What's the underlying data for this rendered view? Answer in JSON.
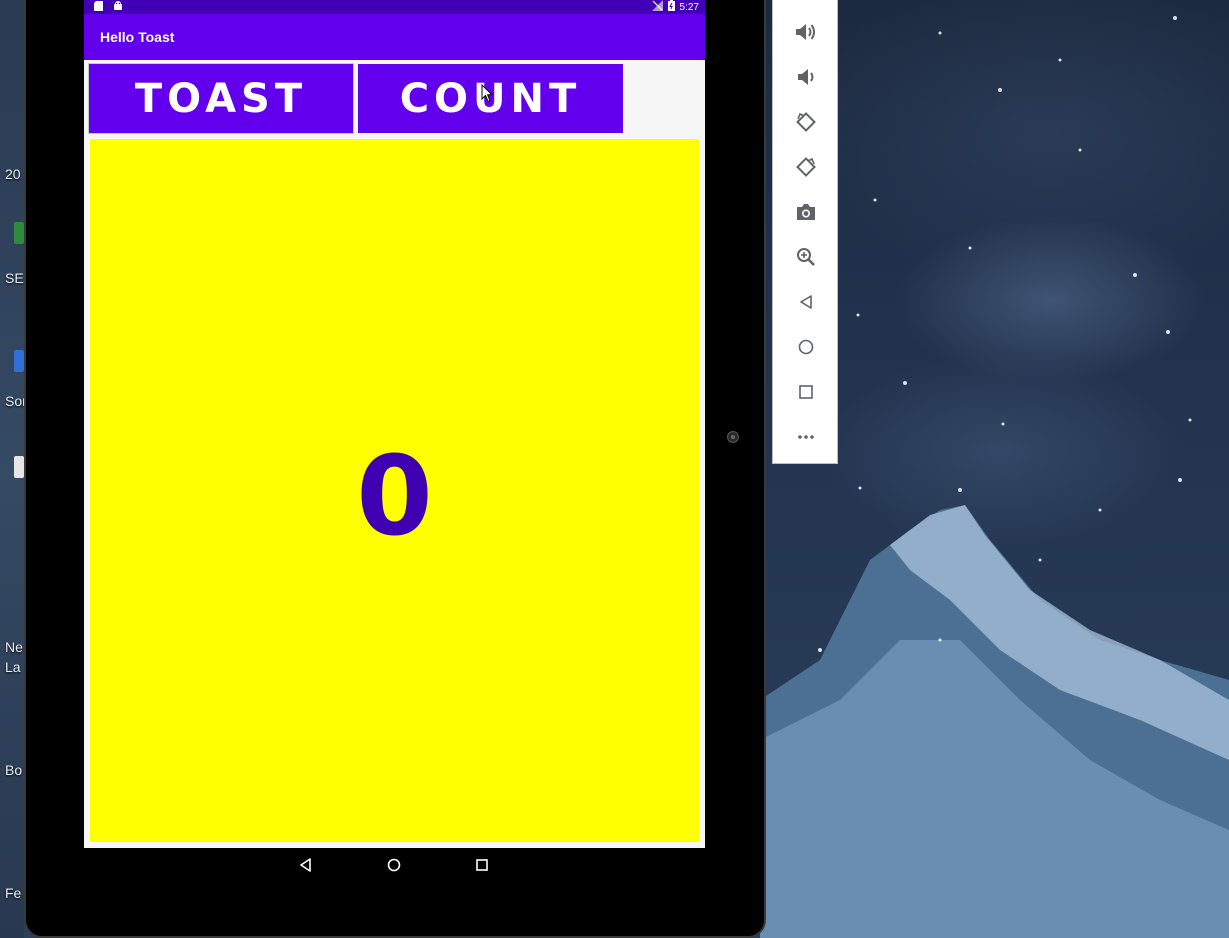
{
  "desktop": {
    "labels": [
      "20",
      "SE",
      "Sor",
      "Ne",
      "La",
      "Bo",
      "Fe"
    ]
  },
  "status_bar": {
    "time": "5:27",
    "icons": [
      "sd-card-icon",
      "android-icon",
      "no-signal-icon",
      "battery-icon"
    ]
  },
  "app": {
    "title": "Hello Toast",
    "toast_button_label": "TOAST",
    "count_button_label": "COUNT",
    "count_value": "0",
    "colors": {
      "primary": "#6200ee",
      "status_bar": "#4100b5",
      "count_background": "#ffff00",
      "count_text": "#3f00b2"
    }
  },
  "navigation": {
    "buttons": [
      "back-icon",
      "home-icon",
      "recents-icon"
    ]
  },
  "emulator_toolbar": {
    "tools": [
      "volume-up-icon",
      "volume-down-icon",
      "rotate-left-icon",
      "rotate-right-icon",
      "camera-icon",
      "zoom-icon",
      "back-icon",
      "home-icon",
      "overview-icon",
      "more-icon"
    ]
  }
}
